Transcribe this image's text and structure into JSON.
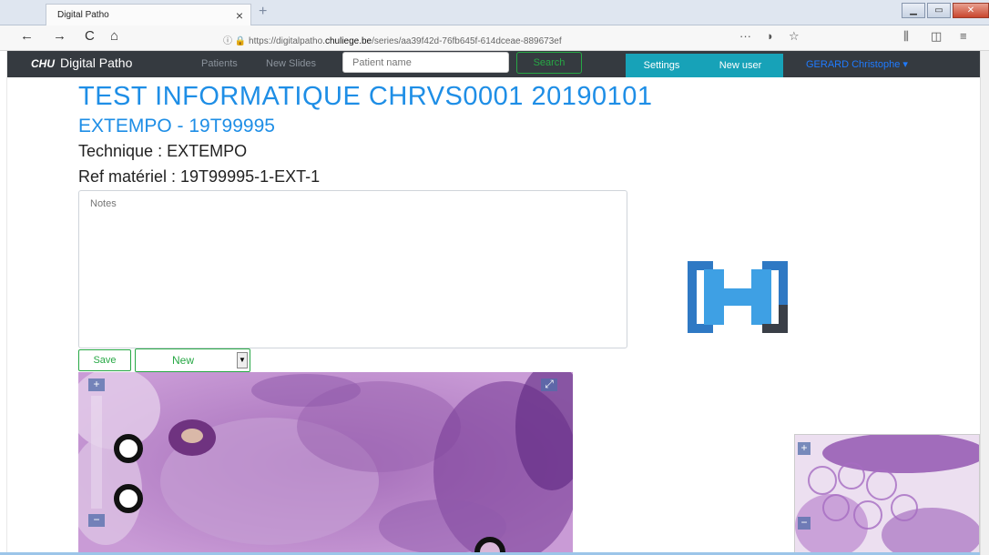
{
  "browser": {
    "tab_title": "Digital Patho",
    "tab_close": "×",
    "new_tab": "+",
    "url_prefix": "https://digitalpatho.",
    "url_host": "chuliege.be",
    "url_path": "/series/aa39f42d-76fb645f-614dceae-889673ef",
    "url_more": "···",
    "back": "←",
    "forward": "→",
    "reload": "C",
    "home": "⌂"
  },
  "app": {
    "brand_logo": "CHU",
    "brand": "Digital Patho",
    "nav": {
      "patients": "Patients",
      "new_slides": "New Slides"
    },
    "search_placeholder": "Patient name",
    "search_label": "Search",
    "settings_label": "Settings",
    "new_user_label": "New user",
    "user": "GERARD Christophe ▾"
  },
  "page": {
    "title": "TEST INFORMATIQUE CHRVS0001 20190101",
    "subtitle": "EXTEMPO - 19T99995",
    "technique": "Technique : EXTEMPO",
    "ref": "Ref matériel : 19T99995-1-EXT-1",
    "notes_placeholder": "Notes",
    "save_label": "Save",
    "new_label": "New"
  },
  "colors": {
    "accent": "#1e8ee6",
    "nav_bg": "#353a40",
    "teal": "#17a2b8",
    "green": "#27a845",
    "tissue": "#b98ac9"
  }
}
